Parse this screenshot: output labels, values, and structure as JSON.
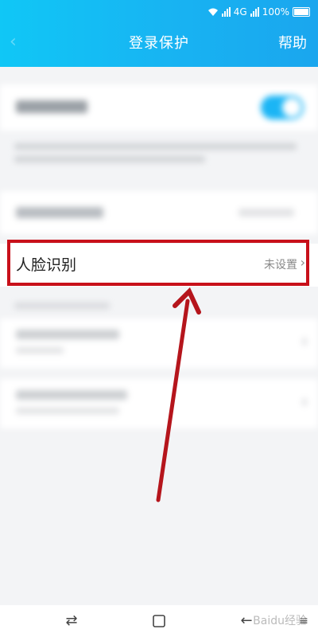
{
  "status_bar": {
    "network": "4G",
    "battery": "100%"
  },
  "header": {
    "back_icon": "back-arrow-icon",
    "title": "登录保护",
    "help_label": "帮助"
  },
  "face_row": {
    "label": "人脸识别",
    "status": "未设置",
    "chevron": "›"
  },
  "navbar": {
    "icons": [
      "switch-icon",
      "home-square-icon",
      "back-icon",
      "menu-icon"
    ]
  },
  "watermark": {
    "text": "Baidu经验"
  },
  "colors": {
    "header": "#18b3f2",
    "highlight": "#c8101a"
  }
}
